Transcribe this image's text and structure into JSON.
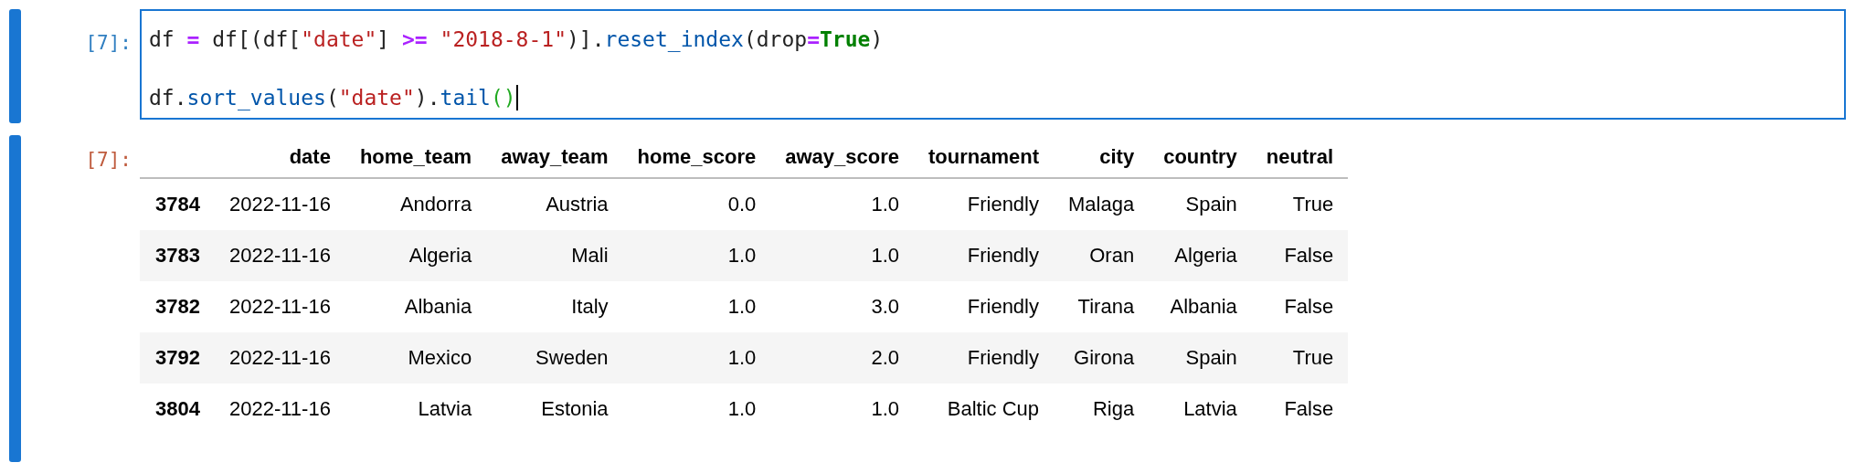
{
  "input_cell": {
    "prompt": "[7]:",
    "focused": true,
    "cursor": true,
    "lines": [
      {
        "tokens": [
          {
            "kind": "text",
            "text": "df "
          },
          {
            "kind": "operator",
            "text": "="
          },
          {
            "kind": "text",
            "text": " df[(df["
          },
          {
            "kind": "string",
            "text": "\"date\""
          },
          {
            "kind": "text",
            "text": "] "
          },
          {
            "kind": "operator",
            "text": ">= "
          },
          {
            "kind": "string",
            "text": "\"2018-8-1\""
          },
          {
            "kind": "text",
            "text": ")]."
          },
          {
            "kind": "method",
            "text": "reset_index"
          },
          {
            "kind": "text",
            "text": "(drop"
          },
          {
            "kind": "operator",
            "text": "="
          },
          {
            "kind": "keyword",
            "text": "True"
          },
          {
            "kind": "text",
            "text": ")"
          }
        ]
      },
      {
        "tokens": [
          {
            "kind": "text",
            "text": "df."
          },
          {
            "kind": "method",
            "text": "sort_values"
          },
          {
            "kind": "text",
            "text": "("
          },
          {
            "kind": "string",
            "text": "\"date\""
          },
          {
            "kind": "text",
            "text": ")."
          },
          {
            "kind": "method",
            "text": "tail"
          },
          {
            "kind": "bracket-match",
            "text": "()"
          }
        ]
      }
    ]
  },
  "output_cell": {
    "prompt": "[7]:",
    "table": {
      "columns": [
        "date",
        "home_team",
        "away_team",
        "home_score",
        "away_score",
        "tournament",
        "city",
        "country",
        "neutral"
      ],
      "rows": [
        {
          "index": "3784",
          "cells": [
            "2022-11-16",
            "Andorra",
            "Austria",
            "0.0",
            "1.0",
            "Friendly",
            "Malaga",
            "Spain",
            "True"
          ]
        },
        {
          "index": "3783",
          "cells": [
            "2022-11-16",
            "Algeria",
            "Mali",
            "1.0",
            "1.0",
            "Friendly",
            "Oran",
            "Algeria",
            "False"
          ]
        },
        {
          "index": "3782",
          "cells": [
            "2022-11-16",
            "Albania",
            "Italy",
            "1.0",
            "3.0",
            "Friendly",
            "Tirana",
            "Albania",
            "False"
          ]
        },
        {
          "index": "3792",
          "cells": [
            "2022-11-16",
            "Mexico",
            "Sweden",
            "1.0",
            "2.0",
            "Friendly",
            "Girona",
            "Spain",
            "True"
          ]
        },
        {
          "index": "3804",
          "cells": [
            "2022-11-16",
            "Latvia",
            "Estonia",
            "1.0",
            "1.0",
            "Baltic Cup",
            "Riga",
            "Latvia",
            "False"
          ]
        }
      ]
    }
  }
}
